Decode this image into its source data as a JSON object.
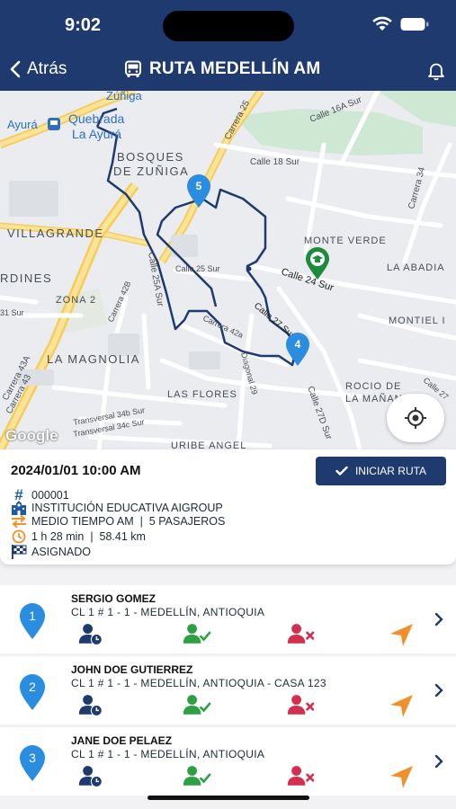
{
  "status_bar": {
    "time": "9:02"
  },
  "nav": {
    "back_label": "Atrás",
    "title": "RUTA MEDELLÍN AM",
    "title_icon": "bus-icon",
    "right_icon": "bell-icon"
  },
  "map": {
    "labels": [
      "Zúñiga",
      "Ayurá",
      "Quebrada",
      "La Ayurá",
      "BOSQUES",
      "DE ZUÑIGA",
      "VILLAGRANDE",
      "RDINES",
      "ZONA 2",
      "LA MAGNOLIA",
      "LAS FLORES",
      "URIBE ANGEL",
      "MONTE VERDE",
      "LA ABADIA",
      "MONTIEL I",
      "ROCIO DE",
      "LA MAÑANA",
      "Carrera 25",
      "Calle 18 Sur",
      "Carrera 34",
      "Calle 24 Sur",
      "Calle 25 Sur",
      "Calle 25A Sur",
      "Calle 27 Sur",
      "Calle 27D Sur",
      "Carrera 42B",
      "Carrera 42a",
      "Diagonal 29",
      "Transversal 34b Sur",
      "Transversal 34c Sur",
      "Carrera 43A",
      "Carrera 43",
      "Calle 16A Sur",
      "Calle 27",
      "31 Sur"
    ],
    "markers": [
      {
        "number": "5",
        "color": "#2a8de0"
      },
      {
        "number": "4",
        "color": "#2a8de0"
      },
      {
        "number": "",
        "color": "#1d8a3c",
        "icon": "graduation-cap-icon"
      }
    ],
    "attribution": "Google",
    "locate_icon": "crosshair-icon"
  },
  "route": {
    "datetime": "2024/01/01 10:00 AM",
    "start_button": "INICIAR RUTA",
    "code": "000001",
    "institution": "INSTITUCIÓN EDUCATIVA AIGROUP",
    "schedule": "MEDIO TIEMPO AM  |  5 PASAJEROS",
    "duration": "1 h 28 min  |  58.41 km",
    "status": "ASIGNADO"
  },
  "stops": [
    {
      "number": "1",
      "name": "SERGIO GOMEZ",
      "address": "CL 1 # 1 - 1 - MEDELLÍN, ANTIOQUIA"
    },
    {
      "number": "2",
      "name": "JOHN DOE GUTIERREZ",
      "address": "CL 1 # 1 - 1 - MEDELLÍN, ANTIOQUIA - CASA 123"
    },
    {
      "number": "3",
      "name": "JANE DOE PELAEZ",
      "address": "CL 1 # 1 - 1 - MEDELLÍN, ANTIOQUIA"
    }
  ],
  "colors": {
    "primary": "#1e3a6e",
    "pin_blue": "#2a8de0",
    "present_green": "#2ea043",
    "absent_red": "#d32f4f",
    "navigate_orange": "#f0902a"
  }
}
